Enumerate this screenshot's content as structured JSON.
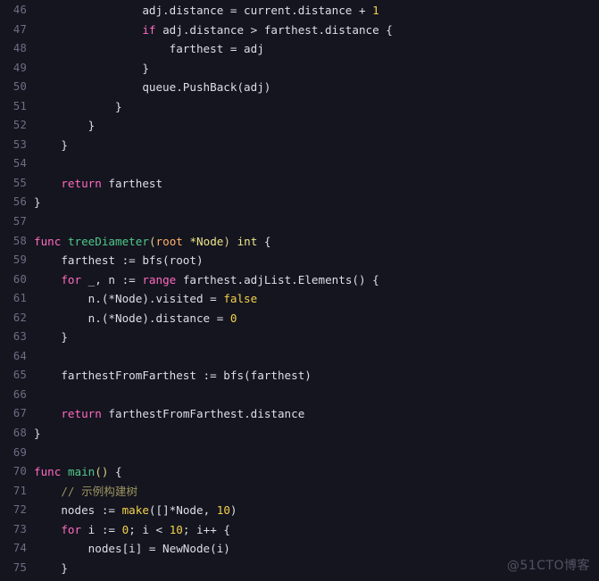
{
  "editor": {
    "theme_name": "dark-navy",
    "language": "go",
    "background_color": "#15151f",
    "gutter_color": "#6b6f85",
    "plain_text_color": "#dcdfe8",
    "first_line_number": 46,
    "last_line_number": 75,
    "colors": {
      "keyword": "#ff6ac1",
      "function": "#4fc98a",
      "builtin": "#f2d24b",
      "number": "#f2d24b",
      "type": "#ebe58a",
      "parameter": "#ffb06b",
      "comment": "#9a9460"
    }
  },
  "watermark": {
    "text": "@51CTO博客"
  },
  "lines": [
    {
      "n": "46",
      "text": "                adj.distance = current.distance + 1"
    },
    {
      "n": "47",
      "text": "                if adj.distance > farthest.distance {"
    },
    {
      "n": "48",
      "text": "                    farthest = adj"
    },
    {
      "n": "49",
      "text": "                }"
    },
    {
      "n": "50",
      "text": "                queue.PushBack(adj)"
    },
    {
      "n": "51",
      "text": "            }"
    },
    {
      "n": "52",
      "text": "        }"
    },
    {
      "n": "53",
      "text": "    }"
    },
    {
      "n": "54",
      "text": ""
    },
    {
      "n": "55",
      "text": "    return farthest"
    },
    {
      "n": "56",
      "text": "}"
    },
    {
      "n": "57",
      "text": ""
    },
    {
      "n": "58",
      "text": "func treeDiameter(root *Node) int {"
    },
    {
      "n": "59",
      "text": "    farthest := bfs(root)"
    },
    {
      "n": "60",
      "text": "    for _, n := range farthest.adjList.Elements() {"
    },
    {
      "n": "61",
      "text": "        n.(*Node).visited = false"
    },
    {
      "n": "62",
      "text": "        n.(*Node).distance = 0"
    },
    {
      "n": "63",
      "text": "    }"
    },
    {
      "n": "64",
      "text": ""
    },
    {
      "n": "65",
      "text": "    farthestFromFarthest := bfs(farthest)"
    },
    {
      "n": "66",
      "text": ""
    },
    {
      "n": "67",
      "text": "    return farthestFromFarthest.distance"
    },
    {
      "n": "68",
      "text": "}"
    },
    {
      "n": "69",
      "text": ""
    },
    {
      "n": "70",
      "text": "func main() {"
    },
    {
      "n": "71",
      "text": "    // 示例构建树"
    },
    {
      "n": "72",
      "text": "    nodes := make([]*Node, 10)"
    },
    {
      "n": "73",
      "text": "    for i := 0; i < 10; i++ {"
    },
    {
      "n": "74",
      "text": "        nodes[i] = NewNode(i)"
    },
    {
      "n": "75",
      "text": "    }"
    }
  ],
  "tokens": {
    "46": [
      [
        "                adj.distance = current.distance + ",
        "pl"
      ],
      [
        "1",
        "num"
      ]
    ],
    "47": [
      [
        "                ",
        "pl"
      ],
      [
        "if",
        "kw"
      ],
      [
        " adj.distance > farthest.distance {",
        "pl"
      ]
    ],
    "48": [
      [
        "                    farthest = adj",
        "pl"
      ]
    ],
    "49": [
      [
        "                }",
        "pl"
      ]
    ],
    "50": [
      [
        "                queue.PushBack(adj)",
        "pl"
      ]
    ],
    "51": [
      [
        "            }",
        "pl"
      ]
    ],
    "52": [
      [
        "        }",
        "pl"
      ]
    ],
    "53": [
      [
        "    }",
        "pl"
      ]
    ],
    "54": [
      [
        "",
        "pl"
      ]
    ],
    "55": [
      [
        "    ",
        "pl"
      ],
      [
        "return",
        "kw"
      ],
      [
        " farthest",
        "pl"
      ]
    ],
    "56": [
      [
        "}",
        "pl"
      ]
    ],
    "57": [
      [
        "",
        "pl"
      ]
    ],
    "58": [
      [
        "func",
        "kw"
      ],
      [
        " ",
        "pl"
      ],
      [
        "treeDiameter",
        "fn"
      ],
      [
        "(",
        "pn"
      ],
      [
        "root",
        "par"
      ],
      [
        " ",
        "pl"
      ],
      [
        "*Node",
        "typ"
      ],
      [
        ")",
        "pn"
      ],
      [
        " ",
        "pl"
      ],
      [
        "int",
        "typ"
      ],
      [
        " {",
        "pl"
      ]
    ],
    "59": [
      [
        "    farthest := bfs(root)",
        "pl"
      ]
    ],
    "60": [
      [
        "    ",
        "pl"
      ],
      [
        "for",
        "kw"
      ],
      [
        " _, n := ",
        "pl"
      ],
      [
        "range",
        "kw"
      ],
      [
        " farthest.adjList.Elements() {",
        "pl"
      ]
    ],
    "61": [
      [
        "        n.(*Node).visited = ",
        "pl"
      ],
      [
        "false",
        "num"
      ]
    ],
    "62": [
      [
        "        n.(*Node).distance = ",
        "pl"
      ],
      [
        "0",
        "num"
      ]
    ],
    "63": [
      [
        "    }",
        "pl"
      ]
    ],
    "64": [
      [
        "",
        "pl"
      ]
    ],
    "65": [
      [
        "    farthestFromFarthest := bfs(farthest)",
        "pl"
      ]
    ],
    "66": [
      [
        "",
        "pl"
      ]
    ],
    "67": [
      [
        "    ",
        "pl"
      ],
      [
        "return",
        "kw"
      ],
      [
        " farthestFromFarthest.distance",
        "pl"
      ]
    ],
    "68": [
      [
        "}",
        "pl"
      ]
    ],
    "69": [
      [
        "",
        "pl"
      ]
    ],
    "70": [
      [
        "func",
        "kw"
      ],
      [
        " ",
        "pl"
      ],
      [
        "main",
        "fn"
      ],
      [
        "()",
        "pn"
      ],
      [
        " {",
        "pl"
      ]
    ],
    "71": [
      [
        "    ",
        "pl"
      ],
      [
        "// 示例构建树",
        "cmt"
      ]
    ],
    "72": [
      [
        "    nodes := ",
        "pl"
      ],
      [
        "make",
        "bi"
      ],
      [
        "([]*Node, ",
        "pl"
      ],
      [
        "10",
        "num"
      ],
      [
        ")",
        "pl"
      ]
    ],
    "73": [
      [
        "    ",
        "pl"
      ],
      [
        "for",
        "kw"
      ],
      [
        " i := ",
        "pl"
      ],
      [
        "0",
        "num"
      ],
      [
        "; i < ",
        "pl"
      ],
      [
        "10",
        "num"
      ],
      [
        "; i++ {",
        "pl"
      ]
    ],
    "74": [
      [
        "        nodes[i] = NewNode(i)",
        "pl"
      ]
    ],
    "75": [
      [
        "    }",
        "pl"
      ]
    ]
  }
}
